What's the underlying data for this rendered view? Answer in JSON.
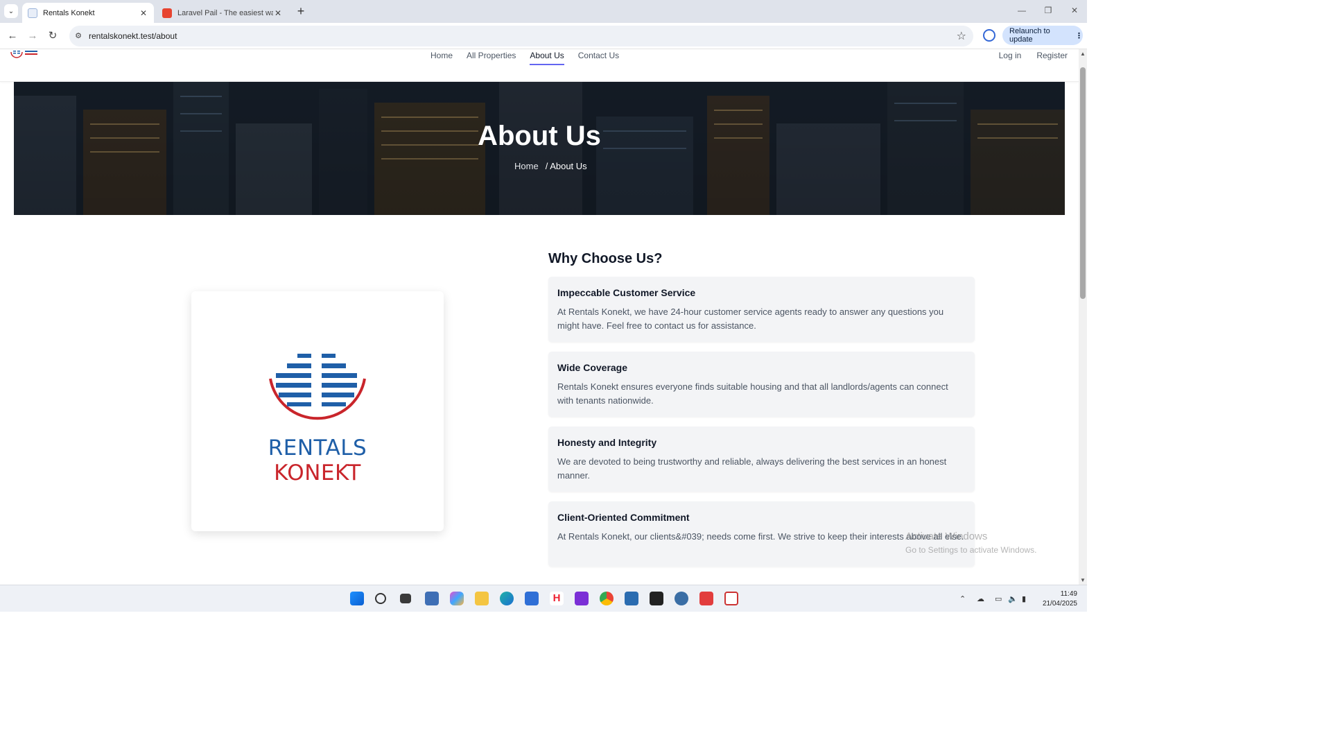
{
  "browser": {
    "tabs": [
      {
        "title": "Rentals Konekt",
        "active": true
      },
      {
        "title": "Laravel Pail - The easiest way to",
        "active": false
      }
    ],
    "url": "rentalskonekt.test/about",
    "relaunch_label": "Relaunch to update"
  },
  "site": {
    "nav": [
      "Home",
      "All Properties",
      "About Us",
      "Contact Us"
    ],
    "active_nav": "About Us",
    "auth": [
      "Log in",
      "Register"
    ],
    "brand_colors": {
      "blue": "#1f5fa8",
      "red": "#c9252b",
      "nav_underline": "#6366f1"
    }
  },
  "hero": {
    "title": "About Us",
    "breadcrumb_home": "Home",
    "breadcrumb_current": "/ About Us"
  },
  "logo_card": {
    "line1": "RENTALS",
    "line2": "KONEKT"
  },
  "why": {
    "heading": "Why Choose Us?",
    "features": [
      {
        "title": "Impeccable Customer Service",
        "text": "At Rentals Konekt, we have 24-hour customer service agents ready to answer any questions you might have. Feel free to contact us for assistance."
      },
      {
        "title": "Wide Coverage",
        "text": "Rentals Konekt ensures everyone finds suitable housing and that all landlords/agents can connect with tenants nationwide."
      },
      {
        "title": "Honesty and Integrity",
        "text": "We are devoted to being trustworthy and reliable, always delivering the best services in an honest manner."
      },
      {
        "title": "Client-Oriented Commitment",
        "text": "At Rentals Konekt, our clients&#039; needs come first. We strive to keep their interests above all else."
      }
    ]
  },
  "watermark": {
    "title": "Activate Windows",
    "subtitle": "Go to Settings to activate Windows."
  },
  "taskbar": {
    "time": "11:49",
    "date": "21/04/2025"
  }
}
